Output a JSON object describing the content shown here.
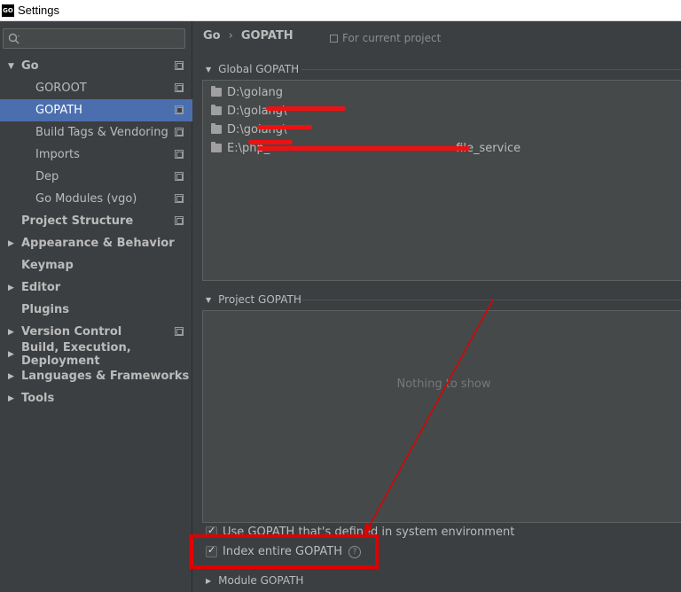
{
  "window": {
    "title": "Settings",
    "app_icon_text": "GO"
  },
  "search": {
    "placeholder": ""
  },
  "sidebar": {
    "items": [
      {
        "label": "Go",
        "bold": true,
        "expanded": true
      },
      {
        "label": "GOROOT"
      },
      {
        "label": "GOPATH",
        "selected": true
      },
      {
        "label": "Build Tags & Vendoring"
      },
      {
        "label": "Imports"
      },
      {
        "label": "Dep"
      },
      {
        "label": "Go Modules (vgo)"
      },
      {
        "label": "Project Structure",
        "bold": true
      },
      {
        "label": "Appearance & Behavior",
        "bold": true,
        "collapsed": true
      },
      {
        "label": "Keymap",
        "bold": true
      },
      {
        "label": "Editor",
        "bold": true,
        "collapsed": true
      },
      {
        "label": "Plugins",
        "bold": true
      },
      {
        "label": "Version Control",
        "bold": true,
        "collapsed": true
      },
      {
        "label": "Build, Execution, Deployment",
        "bold": true,
        "collapsed": true
      },
      {
        "label": "Languages & Frameworks",
        "bold": true,
        "collapsed": true
      },
      {
        "label": "Tools",
        "bold": true,
        "collapsed": true
      }
    ]
  },
  "breadcrumb": {
    "parent": "Go",
    "separator": "›",
    "current": "GOPATH"
  },
  "scope_label": "For current project",
  "global_gopath": {
    "title": "Global GOPATH",
    "paths": [
      "D:\\golang",
      "D:\\golang\\",
      "D:\\golang\\",
      "E:\\php_",
      "file_service"
    ]
  },
  "project_gopath": {
    "title": "Project GOPATH",
    "empty_text": "Nothing to show"
  },
  "options": {
    "use_system_gopath": "Use GOPATH that's defined in system environment",
    "index_entire_gopath": "Index entire GOPATH",
    "help": "?"
  },
  "module_gopath": {
    "title": "Module GOPATH"
  },
  "colors": {
    "accent_selected": "#4b6eaf",
    "annotation_red": "#ee1111"
  }
}
